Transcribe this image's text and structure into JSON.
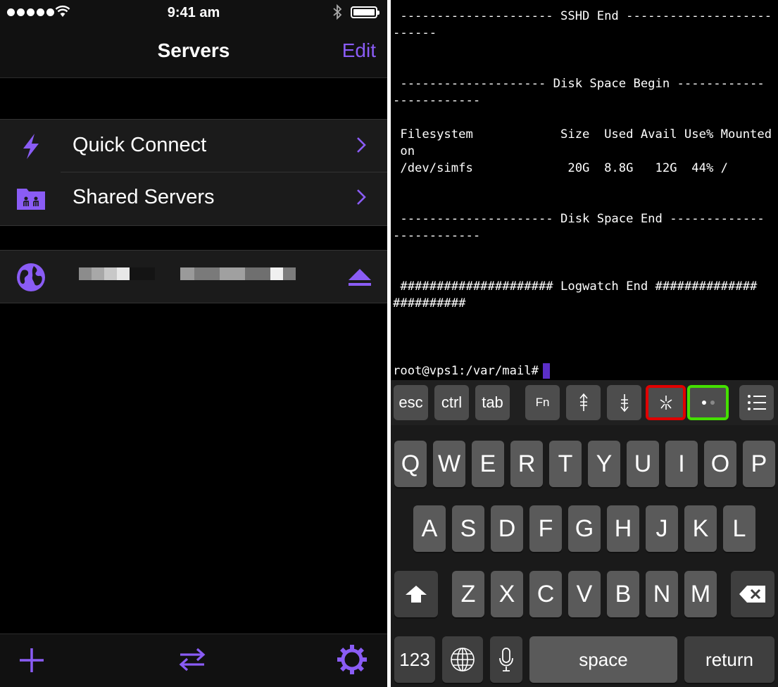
{
  "left": {
    "status": {
      "time": "9:41 am"
    },
    "nav": {
      "title": "Servers",
      "edit": "Edit"
    },
    "rows": [
      {
        "label": "Quick Connect",
        "icon": "lightning-icon"
      },
      {
        "label": "Shared Servers",
        "icon": "shared-folder-icon"
      }
    ],
    "server": {
      "icon": "globe-icon",
      "name_redacted": true,
      "action_icon": "eject-icon"
    },
    "toolbar": {
      "icons": [
        "plus-icon",
        "transfer-icon",
        "settings-gear-icon"
      ]
    },
    "colors": {
      "accent": "#8a5cf5"
    }
  },
  "right": {
    "terminal": {
      "lines": [
        " --------------------- SSHD End --------------------",
        "------",
        " -------------------- Disk Space Begin ------------",
        "------------",
        " Filesystem            Size  Used Avail Use% Mounted",
        " on",
        " /dev/simfs             20G  8.8G   12G  44% /",
        " --------------------- Disk Space End -------------",
        "------------",
        " ##################### Logwatch End ##############",
        "##########"
      ],
      "prompt": "root@vps1:/var/mail#"
    },
    "accessory": {
      "esc": "esc",
      "ctrl": "ctrl",
      "tab": "tab",
      "fn": "Fn"
    },
    "keys": {
      "row1": [
        "Q",
        "W",
        "E",
        "R",
        "T",
        "Y",
        "U",
        "I",
        "O",
        "P"
      ],
      "row2": [
        "A",
        "S",
        "D",
        "F",
        "G",
        "H",
        "J",
        "K",
        "L"
      ],
      "row3": [
        "Z",
        "X",
        "C",
        "V",
        "B",
        "N",
        "M"
      ],
      "numbers": "123",
      "space": "space",
      "return": "return"
    },
    "highlights": {
      "red": "#e00000",
      "green": "#44e000"
    }
  }
}
